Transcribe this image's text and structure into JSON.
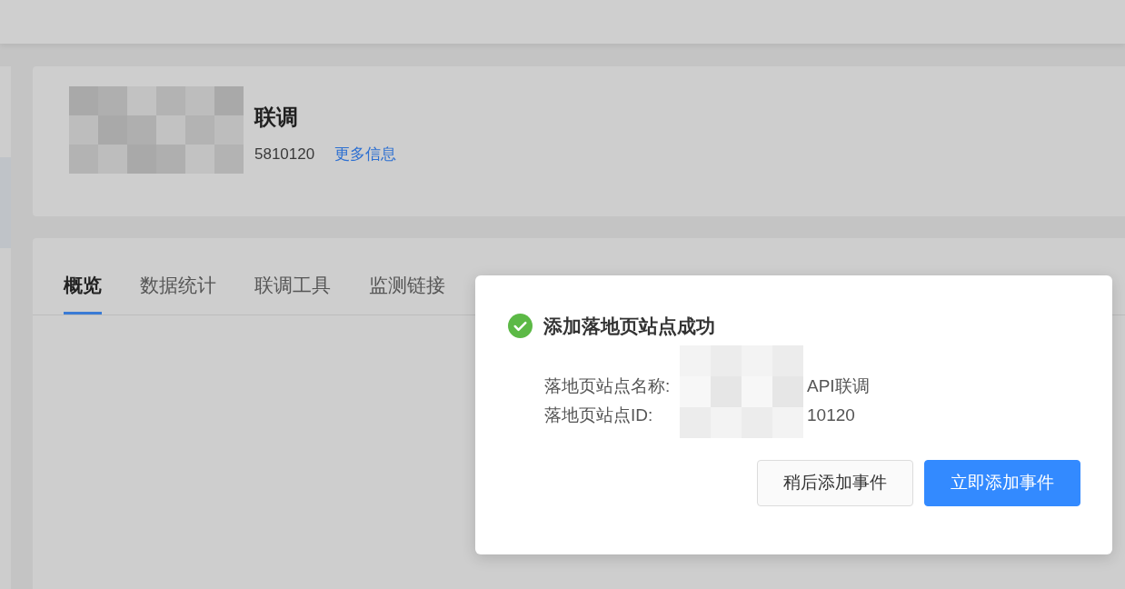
{
  "header": {
    "title": "联调",
    "id_text": "5810120",
    "more_link": "更多信息"
  },
  "tabs": [
    {
      "label": "概览",
      "selected": true
    },
    {
      "label": "数据统计",
      "selected": false
    },
    {
      "label": "联调工具",
      "selected": false
    },
    {
      "label": "监测链接",
      "selected": false
    }
  ],
  "dialog": {
    "title": "添加落地页站点成功",
    "fields": [
      {
        "label": "落地页站点名称:",
        "value": "API联调"
      },
      {
        "label": "落地页站点ID:",
        "value": "10120"
      }
    ],
    "buttons": [
      {
        "label": "稍后添加事件",
        "kind": "secondary"
      },
      {
        "label": "立即添加事件",
        "kind": "primary"
      }
    ]
  }
}
